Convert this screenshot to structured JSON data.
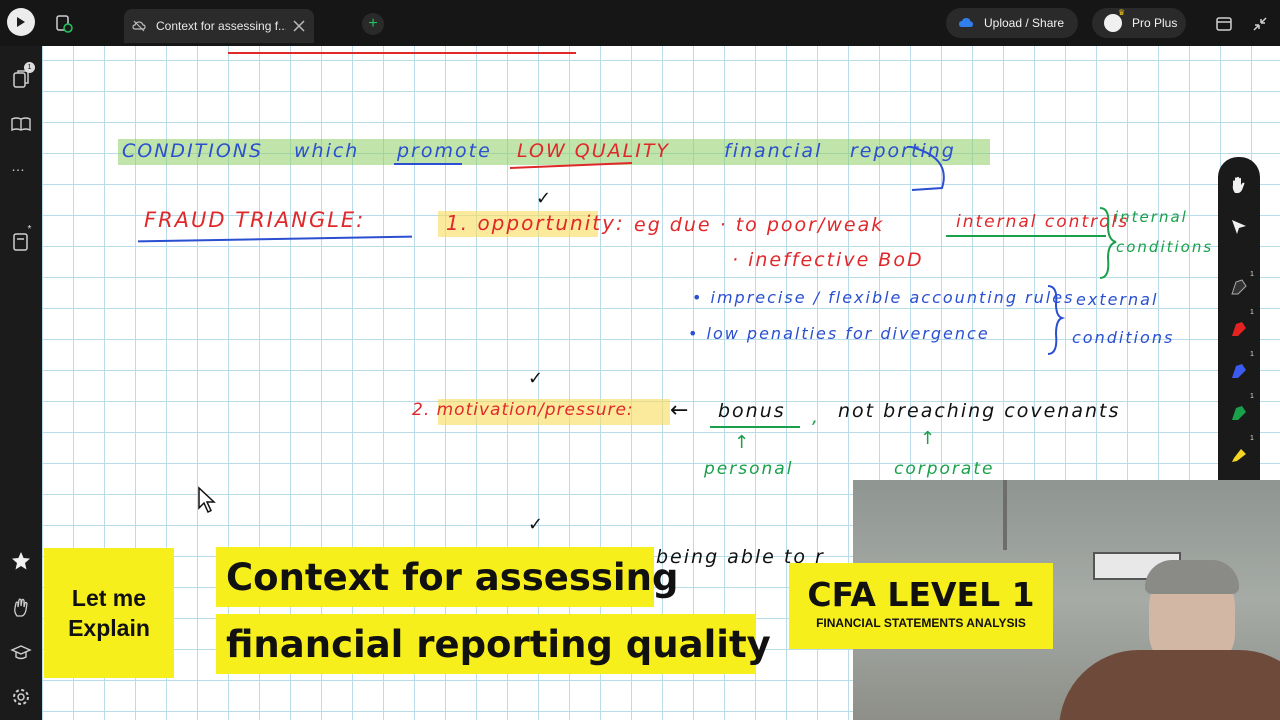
{
  "topbar": {
    "tab_title": "Context for assessing f... *",
    "new_tab_label": "+",
    "upload_label": "Upload / Share",
    "plan_label": "Pro Plus"
  },
  "sidebar": {
    "pages_badge": "1",
    "more_label": "…",
    "notebook_badge": "*"
  },
  "toolbar": {
    "counts": [
      "1",
      "1",
      "1",
      "1",
      "1"
    ]
  },
  "canvas": {
    "heading": {
      "w1": "CONDITIONS",
      "w2": "which",
      "w3": "promote",
      "w4": "LOW QUALITY",
      "w5": "financial",
      "w6": "reporting"
    },
    "fraud_triangle": "FRAUD TRIANGLE:",
    "item1_label": "1. opportunity:",
    "item1_text": "eg due · to poor/weak",
    "item1_controls": "internal controls",
    "item1_ineffective": "· ineffective BoD",
    "internal_conditions_1": "internal",
    "internal_conditions_2": "conditions",
    "item1_imprecise": "• imprecise / flexible accounting rules",
    "item1_penalties": "• low penalties for divergence",
    "external_conditions_1": "external",
    "external_conditions_2": "conditions",
    "check_mark": "✓",
    "item2_label": "2. motivation/pressure:",
    "item2_arrow": "←",
    "item2_bonus": "bonus",
    "item2_comma": ",",
    "item2_rest": "not breaching covenants",
    "personal": "personal",
    "corporate": "corporate",
    "item3_partial": "being able to r",
    "up_arrow": "↑"
  },
  "overlay": {
    "badge_line1": "Let me",
    "badge_line2": "Explain",
    "title_line1": "Context for assessing",
    "title_line2": "financial reporting quality",
    "cfa_title": "CFA LEVEL 1",
    "cfa_subtitle": "FINANCIAL STATEMENTS ANALYSIS"
  }
}
